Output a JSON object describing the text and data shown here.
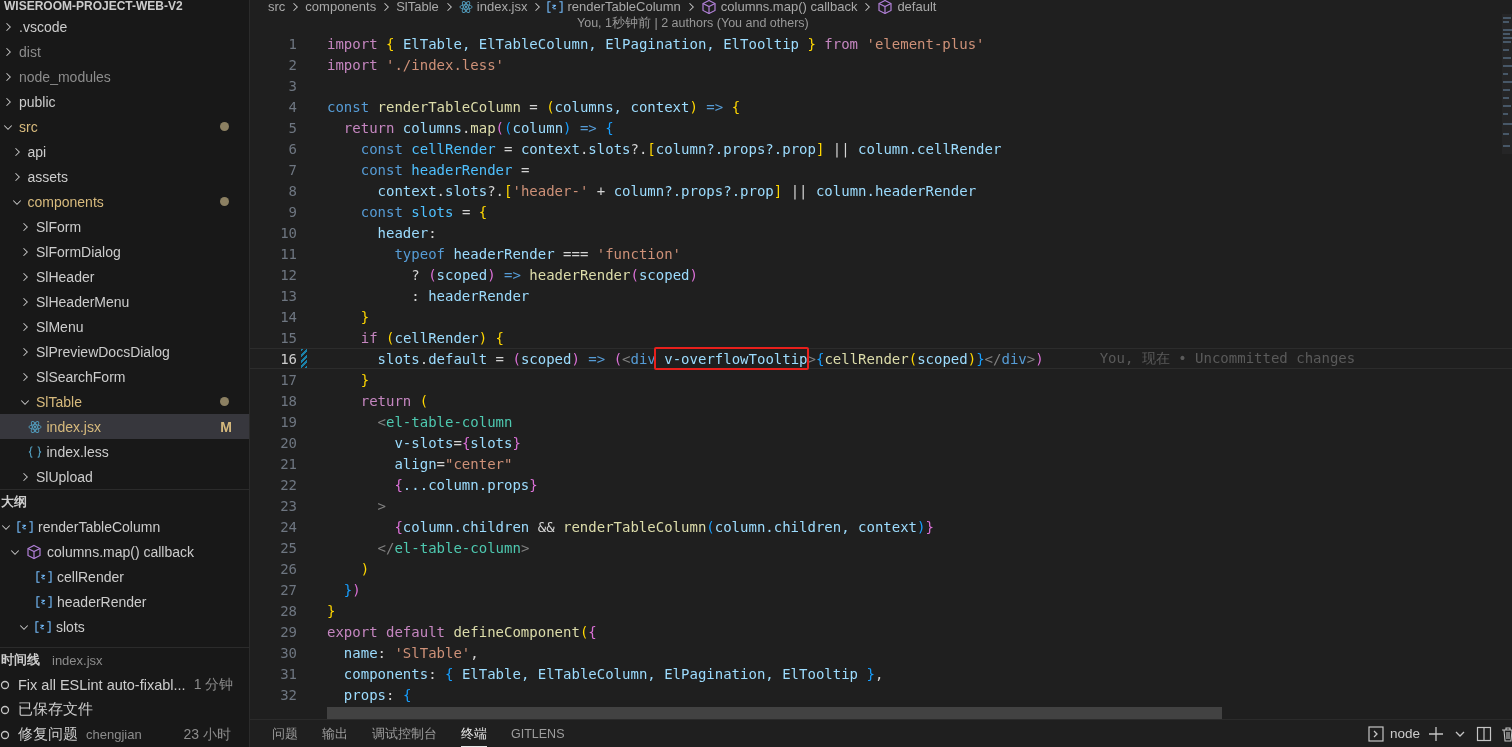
{
  "explorer": {
    "title": "WISEROOM-PROJECT-WEB-V2",
    "items": [
      {
        "name": ".vscode",
        "kind": "folder",
        "expanded": false
      },
      {
        "name": "dist",
        "kind": "folder",
        "expanded": false,
        "dimmed": true
      },
      {
        "name": "node_modules",
        "kind": "folder",
        "expanded": false,
        "dimmed": true
      },
      {
        "name": "public",
        "kind": "folder",
        "expanded": false
      },
      {
        "name": "src",
        "kind": "folder",
        "expanded": true,
        "modified": true,
        "children": [
          {
            "name": "api",
            "kind": "folder",
            "expanded": false
          },
          {
            "name": "assets",
            "kind": "folder",
            "expanded": false
          },
          {
            "name": "components",
            "kind": "folder",
            "expanded": true,
            "modified": true,
            "children": [
              {
                "name": "SlForm",
                "kind": "folder",
                "expanded": false
              },
              {
                "name": "SlFormDialog",
                "kind": "folder",
                "expanded": false
              },
              {
                "name": "SlHeader",
                "kind": "folder",
                "expanded": false
              },
              {
                "name": "SlHeaderMenu",
                "kind": "folder",
                "expanded": false
              },
              {
                "name": "SlMenu",
                "kind": "folder",
                "expanded": false
              },
              {
                "name": "SlPreviewDocsDialog",
                "kind": "folder",
                "expanded": false
              },
              {
                "name": "SlSearchForm",
                "kind": "folder",
                "expanded": false
              },
              {
                "name": "SlTable",
                "kind": "folder",
                "expanded": true,
                "modified": true,
                "children": [
                  {
                    "name": "index.jsx",
                    "kind": "jsx",
                    "selected": true,
                    "badge": "M"
                  },
                  {
                    "name": "index.less",
                    "kind": "less",
                    "selected": false
                  }
                ]
              },
              {
                "name": "SlUpload",
                "kind": "folder",
                "expanded": false
              }
            ]
          }
        ]
      }
    ]
  },
  "outline": {
    "title": "大纲",
    "items": [
      {
        "name": "renderTableColumn",
        "kind": "variable",
        "expanded": true,
        "children": [
          {
            "name": "columns.map() callback",
            "kind": "method",
            "expanded": true,
            "children": [
              {
                "name": "cellRender",
                "kind": "variable"
              },
              {
                "name": "headerRender",
                "kind": "variable"
              },
              {
                "name": "slots",
                "kind": "variable",
                "expanded": true
              }
            ]
          }
        ]
      }
    ]
  },
  "timeline": {
    "title": "时间线",
    "file": "index.jsx",
    "items": [
      {
        "label": "Fix all ESLint auto-fixabl...",
        "time": "1 分钟"
      },
      {
        "label": "已保存文件"
      },
      {
        "label": "修复问题",
        "author": "chengjian",
        "time": "23 小时"
      }
    ]
  },
  "breadcrumb": [
    {
      "label": "src",
      "kind": "folder"
    },
    {
      "label": "components",
      "kind": "folder"
    },
    {
      "label": "SlTable",
      "kind": "folder"
    },
    {
      "label": "index.jsx",
      "kind": "jsx"
    },
    {
      "label": "renderTableColumn",
      "kind": "variable"
    },
    {
      "label": "columns.map() callback",
      "kind": "method"
    },
    {
      "label": "default",
      "kind": "method"
    }
  ],
  "editor": {
    "codelens": "You, 1秒钟前 | 2 authors (You and others)",
    "lines": [
      {
        "number": "1",
        "tokens": [
          {
            "text": "import ",
            "kind": "control"
          },
          {
            "text": "{",
            "kind": "brace1"
          },
          {
            "text": " ElTable, ElTableColumn, ElPagination, ElTooltip ",
            "kind": "variable"
          },
          {
            "text": "} ",
            "kind": "brace1"
          },
          {
            "text": "from ",
            "kind": "control"
          },
          {
            "text": "'element-plus'",
            "kind": "string"
          }
        ]
      },
      {
        "number": "2",
        "tokens": [
          {
            "text": "import ",
            "kind": "control"
          },
          {
            "text": "'./index.less'",
            "kind": "string"
          }
        ]
      },
      {
        "number": "3"
      },
      {
        "number": "4",
        "tokens": [
          {
            "text": "const ",
            "kind": "keyword"
          },
          {
            "text": "renderTableColumn",
            "kind": "function"
          },
          {
            "text": " = ",
            "kind": "plain"
          },
          {
            "text": "(",
            "kind": "brace1"
          },
          {
            "text": "columns, context",
            "kind": "variable"
          },
          {
            "text": ")",
            "kind": "brace1"
          },
          {
            "text": " => ",
            "kind": "keyword"
          },
          {
            "text": "{",
            "kind": "brace1"
          }
        ]
      },
      {
        "number": "5",
        "tokens": [
          {
            "text": "  return ",
            "kind": "control"
          },
          {
            "text": "columns",
            "kind": "variable"
          },
          {
            "text": ".",
            "kind": "plain"
          },
          {
            "text": "map",
            "kind": "function"
          },
          {
            "text": "(",
            "kind": "brace2"
          },
          {
            "text": "(",
            "kind": "brace3"
          },
          {
            "text": "column",
            "kind": "variable"
          },
          {
            "text": ")",
            "kind": "brace3"
          },
          {
            "text": " => ",
            "kind": "keyword"
          },
          {
            "text": "{",
            "kind": "brace3"
          }
        ]
      },
      {
        "number": "6",
        "tokens": [
          {
            "text": "    const ",
            "kind": "keyword"
          },
          {
            "text": "cellRender",
            "kind": "constant"
          },
          {
            "text": " = ",
            "kind": "plain"
          },
          {
            "text": "context",
            "kind": "variable"
          },
          {
            "text": ".",
            "kind": "plain"
          },
          {
            "text": "slots",
            "kind": "variable"
          },
          {
            "text": "?.",
            "kind": "plain"
          },
          {
            "text": "[",
            "kind": "brace1"
          },
          {
            "text": "column?.props?.prop",
            "kind": "variable"
          },
          {
            "text": "]",
            "kind": "brace1"
          },
          {
            "text": " || ",
            "kind": "plain"
          },
          {
            "text": "column.cellRender",
            "kind": "variable"
          }
        ]
      },
      {
        "number": "7",
        "tokens": [
          {
            "text": "    const ",
            "kind": "keyword"
          },
          {
            "text": "headerRender",
            "kind": "constant"
          },
          {
            "text": " =",
            "kind": "plain"
          }
        ]
      },
      {
        "number": "8",
        "tokens": [
          {
            "text": "      context",
            "kind": "variable"
          },
          {
            "text": ".",
            "kind": "plain"
          },
          {
            "text": "slots",
            "kind": "variable"
          },
          {
            "text": "?.",
            "kind": "plain"
          },
          {
            "text": "[",
            "kind": "brace1"
          },
          {
            "text": "'header-'",
            "kind": "string"
          },
          {
            "text": " + ",
            "kind": "plain"
          },
          {
            "text": "column?.props?.prop",
            "kind": "variable"
          },
          {
            "text": "]",
            "kind": "brace1"
          },
          {
            "text": " || ",
            "kind": "plain"
          },
          {
            "text": "column.headerRender",
            "kind": "variable"
          }
        ]
      },
      {
        "number": "9",
        "tokens": [
          {
            "text": "    const ",
            "kind": "keyword"
          },
          {
            "text": "slots",
            "kind": "constant"
          },
          {
            "text": " = ",
            "kind": "plain"
          },
          {
            "text": "{",
            "kind": "brace1"
          }
        ]
      },
      {
        "number": "10",
        "tokens": [
          {
            "text": "      header",
            "kind": "variable"
          },
          {
            "text": ":",
            "kind": "plain"
          }
        ]
      },
      {
        "number": "11",
        "tokens": [
          {
            "text": "        typeof ",
            "kind": "keyword"
          },
          {
            "text": "headerRender",
            "kind": "variable"
          },
          {
            "text": " === ",
            "kind": "plain"
          },
          {
            "text": "'function'",
            "kind": "string"
          }
        ]
      },
      {
        "number": "12",
        "tokens": [
          {
            "text": "          ? ",
            "kind": "plain"
          },
          {
            "text": "(",
            "kind": "brace2"
          },
          {
            "text": "scoped",
            "kind": "variable"
          },
          {
            "text": ")",
            "kind": "brace2"
          },
          {
            "text": " => ",
            "kind": "keyword"
          },
          {
            "text": "headerRender",
            "kind": "function"
          },
          {
            "text": "(",
            "kind": "brace2"
          },
          {
            "text": "scoped",
            "kind": "variable"
          },
          {
            "text": ")",
            "kind": "brace2"
          }
        ]
      },
      {
        "number": "13",
        "tokens": [
          {
            "text": "          : ",
            "kind": "plain"
          },
          {
            "text": "headerRender",
            "kind": "variable"
          }
        ]
      },
      {
        "number": "14",
        "tokens": [
          {
            "text": "    }",
            "kind": "brace1"
          }
        ]
      },
      {
        "number": "15",
        "tokens": [
          {
            "text": "    if ",
            "kind": "control"
          },
          {
            "text": "(",
            "kind": "brace1"
          },
          {
            "text": "cellRender",
            "kind": "variable"
          },
          {
            "text": ") {",
            "kind": "brace1"
          }
        ]
      },
      {
        "number": "16",
        "current": true,
        "changed": true,
        "blame": "You, 现在 • Uncommitted changes",
        "tokens": [
          {
            "text": "      slots",
            "kind": "variable"
          },
          {
            "text": ".",
            "kind": "plain"
          },
          {
            "text": "default",
            "kind": "variable"
          },
          {
            "text": " = ",
            "kind": "plain"
          },
          {
            "text": "(",
            "kind": "brace2"
          },
          {
            "text": "scoped",
            "kind": "variable"
          },
          {
            "text": ")",
            "kind": "brace2"
          },
          {
            "text": " => ",
            "kind": "keyword"
          },
          {
            "text": "(",
            "kind": "brace2"
          },
          {
            "text": "<",
            "kind": "tag-bracket"
          },
          {
            "text": "div ",
            "kind": "keyword"
          },
          {
            "text": "v-overflowTooltip",
            "kind": "variable",
            "boxed": true
          },
          {
            "text": ">",
            "kind": "tag-bracket"
          },
          {
            "text": "{",
            "kind": "brace3"
          },
          {
            "text": "cellRender",
            "kind": "function"
          },
          {
            "text": "(",
            "kind": "brace1"
          },
          {
            "text": "scoped",
            "kind": "variable"
          },
          {
            "text": ")",
            "kind": "brace1"
          },
          {
            "text": "}",
            "kind": "brace3"
          },
          {
            "text": "</",
            "kind": "tag-bracket"
          },
          {
            "text": "div",
            "kind": "keyword"
          },
          {
            "text": ">",
            "kind": "tag-bracket"
          },
          {
            "text": ")",
            "kind": "brace2"
          }
        ]
      },
      {
        "number": "17",
        "tokens": [
          {
            "text": "    }",
            "kind": "brace1"
          }
        ]
      },
      {
        "number": "18",
        "tokens": [
          {
            "text": "    return ",
            "kind": "control"
          },
          {
            "text": "(",
            "kind": "brace1"
          }
        ]
      },
      {
        "number": "19",
        "tokens": [
          {
            "text": "      <",
            "kind": "tag-bracket"
          },
          {
            "text": "el-table-column",
            "kind": "tag"
          }
        ]
      },
      {
        "number": "20",
        "tokens": [
          {
            "text": "        v-slots",
            "kind": "variable"
          },
          {
            "text": "=",
            "kind": "plain"
          },
          {
            "text": "{",
            "kind": "brace2"
          },
          {
            "text": "slots",
            "kind": "variable"
          },
          {
            "text": "}",
            "kind": "brace2"
          }
        ]
      },
      {
        "number": "21",
        "tokens": [
          {
            "text": "        align",
            "kind": "variable"
          },
          {
            "text": "=",
            "kind": "plain"
          },
          {
            "text": "\"center\"",
            "kind": "string"
          }
        ]
      },
      {
        "number": "22",
        "tokens": [
          {
            "text": "        {",
            "kind": "brace2"
          },
          {
            "text": "...column.props",
            "kind": "variable"
          },
          {
            "text": "}",
            "kind": "brace2"
          }
        ]
      },
      {
        "number": "23",
        "tokens": [
          {
            "text": "      >",
            "kind": "tag-bracket"
          }
        ]
      },
      {
        "number": "24",
        "tokens": [
          {
            "text": "        {",
            "kind": "brace2"
          },
          {
            "text": "column.children",
            "kind": "variable"
          },
          {
            "text": " && ",
            "kind": "plain"
          },
          {
            "text": "renderTableColumn",
            "kind": "function"
          },
          {
            "text": "(",
            "kind": "brace3"
          },
          {
            "text": "column.children, context",
            "kind": "variable"
          },
          {
            "text": ")",
            "kind": "brace3"
          },
          {
            "text": "}",
            "kind": "brace2"
          }
        ]
      },
      {
        "number": "25",
        "tokens": [
          {
            "text": "      </",
            "kind": "tag-bracket"
          },
          {
            "text": "el-table-column",
            "kind": "tag"
          },
          {
            "text": ">",
            "kind": "tag-bracket"
          }
        ]
      },
      {
        "number": "26",
        "tokens": [
          {
            "text": "    )",
            "kind": "brace1"
          }
        ]
      },
      {
        "number": "27",
        "tokens": [
          {
            "text": "  }",
            "kind": "brace3"
          },
          {
            "text": ")",
            "kind": "brace2"
          }
        ]
      },
      {
        "number": "28",
        "tokens": [
          {
            "text": "}",
            "kind": "brace1"
          }
        ]
      },
      {
        "number": "29",
        "tokens": [
          {
            "text": "export default ",
            "kind": "control"
          },
          {
            "text": "defineComponent",
            "kind": "function"
          },
          {
            "text": "(",
            "kind": "brace1"
          },
          {
            "text": "{",
            "kind": "brace2"
          }
        ]
      },
      {
        "number": "30",
        "tokens": [
          {
            "text": "  name",
            "kind": "variable"
          },
          {
            "text": ": ",
            "kind": "plain"
          },
          {
            "text": "'SlTable'",
            "kind": "string"
          },
          {
            "text": ",",
            "kind": "plain"
          }
        ]
      },
      {
        "number": "31",
        "tokens": [
          {
            "text": "  components",
            "kind": "variable"
          },
          {
            "text": ": ",
            "kind": "plain"
          },
          {
            "text": "{",
            "kind": "brace3"
          },
          {
            "text": " ElTable, ElTableColumn, ElPagination, ElTooltip ",
            "kind": "variable"
          },
          {
            "text": "}",
            "kind": "brace3"
          },
          {
            "text": ",",
            "kind": "plain"
          }
        ]
      },
      {
        "number": "32",
        "tokens": [
          {
            "text": "  props",
            "kind": "variable"
          },
          {
            "text": ": ",
            "kind": "plain"
          },
          {
            "text": "{",
            "kind": "brace3"
          }
        ]
      }
    ]
  },
  "panel": {
    "tabs": [
      {
        "label": "问题",
        "selected": false
      },
      {
        "label": "输出",
        "selected": false
      },
      {
        "label": "调试控制台",
        "selected": false
      },
      {
        "label": "终端",
        "selected": true
      },
      {
        "label": "GITLENS",
        "selected": false
      }
    ],
    "terminal": "node"
  }
}
